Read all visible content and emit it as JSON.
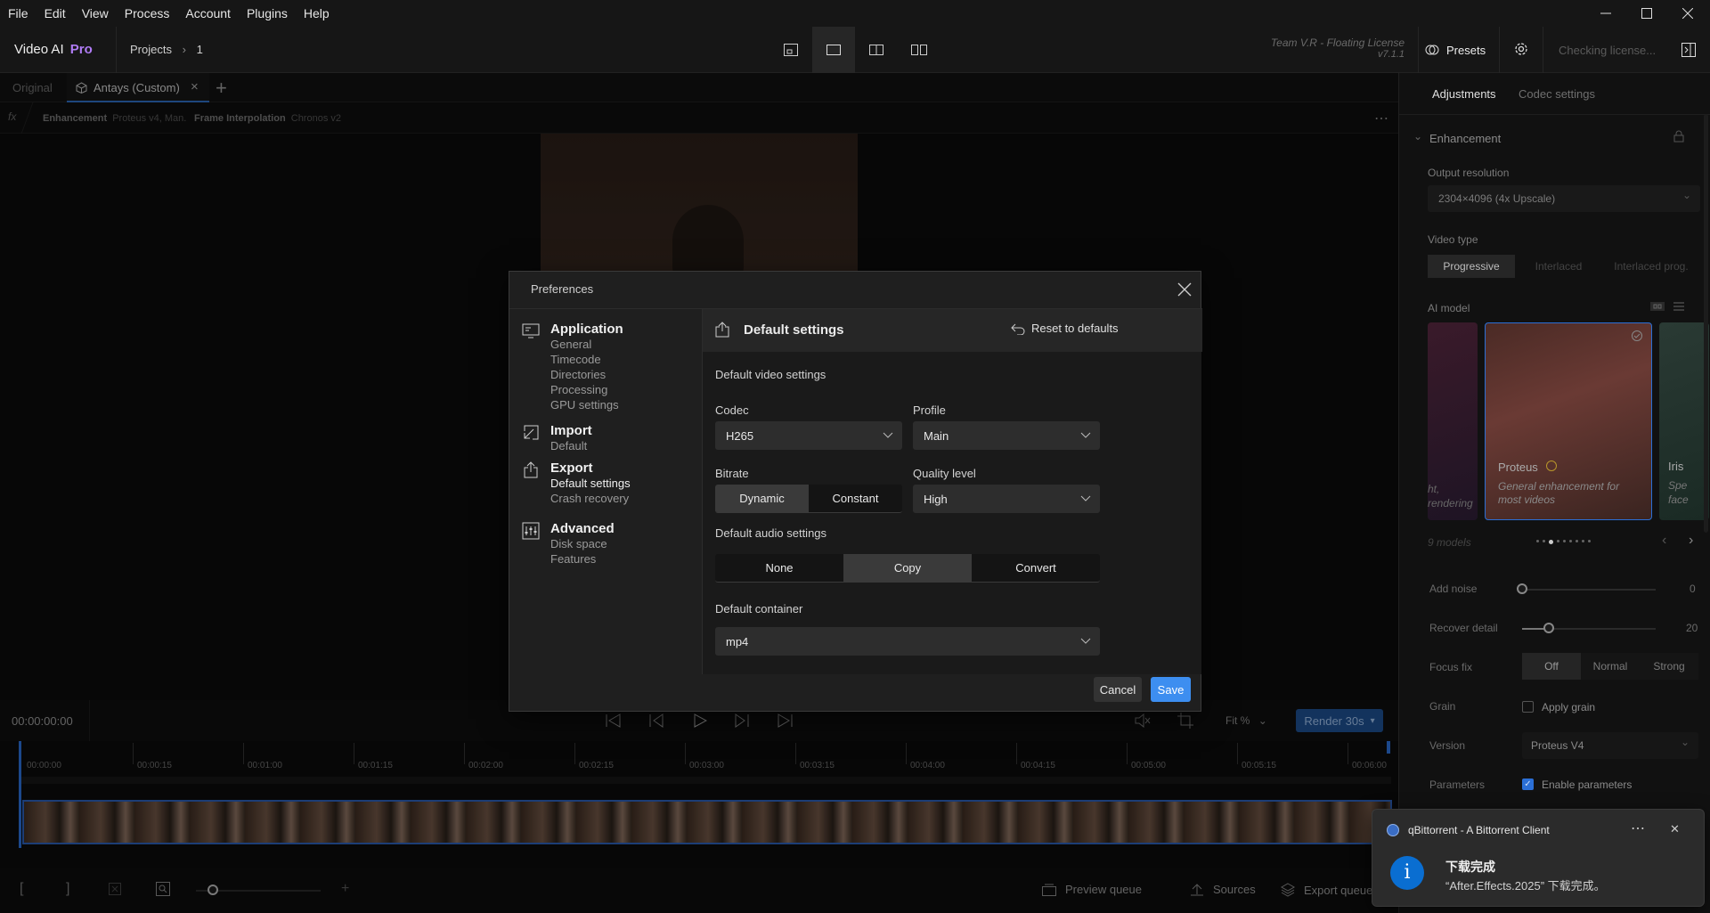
{
  "menu": [
    "File",
    "Edit",
    "View",
    "Process",
    "Account",
    "Plugins",
    "Help"
  ],
  "window_controls": {
    "minimize": "—",
    "maximize": "☐",
    "close": "✕"
  },
  "app": {
    "name": "Video AI",
    "edition": "Pro"
  },
  "breadcrumb": {
    "root": "Projects",
    "sep": "›",
    "current": "1"
  },
  "license": {
    "team": "Team V.R - Floating License",
    "version": "v7.1.1",
    "status": "Checking license..."
  },
  "presets_label": "Presets",
  "tabs": {
    "original": "Original",
    "custom": "Antays (Custom)",
    "close": "×",
    "add": "+"
  },
  "fxbar": {
    "fx": "fx",
    "enh_label": "Enhancement",
    "enh_value": "Proteus v4, Man.",
    "fi_label": "Frame Interpolation",
    "fi_value": "Chronos v2",
    "more": "⋯"
  },
  "transport": {
    "timecode": "00:00:00:00",
    "zoom": "Fit %",
    "render": "Render 30s",
    "render_arrow": "▾"
  },
  "ruler": [
    "00:00:00",
    "00:00:15",
    "00:01:00",
    "00:01:15",
    "00:02:00",
    "00:02:15",
    "00:03:00",
    "00:03:15",
    "00:04:00",
    "00:04:15",
    "00:05:00",
    "00:05:15",
    "00:06:00"
  ],
  "bottom": {
    "preview_queue": "Preview queue",
    "sources": "Sources",
    "export_queue": "Export queue"
  },
  "right": {
    "tab_adjust": "Adjustments",
    "tab_codec": "Codec settings",
    "enhancement": "Enhancement",
    "output_resolution_label": "Output resolution",
    "output_resolution": "2304×4096 (4x Upscale)",
    "video_type_label": "Video type",
    "video_types": [
      "Progressive",
      "Interlaced",
      "Interlaced prog."
    ],
    "ai_model_label": "AI model",
    "left_card": {
      "title": "ht,",
      "sub": "rendering"
    },
    "model_card": {
      "name": "Proteus",
      "desc": "General enhancement for most videos"
    },
    "right_card": {
      "name": "Iris",
      "sub": "Spe",
      "sub2": "face"
    },
    "models_count": "9 models",
    "add_noise": {
      "label": "Add noise",
      "value": "0"
    },
    "recover_detail": {
      "label": "Recover detail",
      "value": "20"
    },
    "focus_fix": {
      "label": "Focus fix",
      "options": [
        "Off",
        "Normal",
        "Strong"
      ]
    },
    "grain": {
      "label": "Grain",
      "option": "Apply grain"
    },
    "version": {
      "label": "Version",
      "value": "Proteus V4"
    },
    "parameters": {
      "label": "Parameters",
      "option": "Enable parameters"
    }
  },
  "dialog": {
    "title": "Preferences",
    "nav": [
      {
        "head": "Application",
        "subs": [
          "General",
          "Timecode",
          "Directories",
          "Processing",
          "GPU settings"
        ]
      },
      {
        "head": "Import",
        "subs": [
          "Default"
        ]
      },
      {
        "head": "Export",
        "subs": [
          "Default settings",
          "Crash recovery"
        ]
      },
      {
        "head": "Advanced",
        "subs": [
          "Disk space",
          "Features"
        ]
      }
    ],
    "content_title": "Default settings",
    "reset": "Reset to defaults",
    "video_section": "Default video settings",
    "codec_label": "Codec",
    "codec": "H265",
    "profile_label": "Profile",
    "profile": "Main",
    "bitrate_label": "Bitrate",
    "bitrate_options": [
      "Dynamic",
      "Constant"
    ],
    "quality_label": "Quality level",
    "quality": "High",
    "audio_section": "Default audio settings",
    "audio_options": [
      "None",
      "Copy",
      "Convert"
    ],
    "container_label": "Default container",
    "container": "mp4",
    "cancel": "Cancel",
    "save": "Save"
  },
  "toast": {
    "app": "qBittorrent - A Bittorrent Client",
    "title": "下载完成",
    "message": "“After.Effects.2025” 下载完成。",
    "more": "⋯",
    "close": "✕",
    "icon": "i"
  },
  "colors": {
    "accent": "#3d8ef0",
    "render": "#1e4f8f",
    "pro": "#b07cf5",
    "filmstrip_border": "#2b5fb6"
  }
}
